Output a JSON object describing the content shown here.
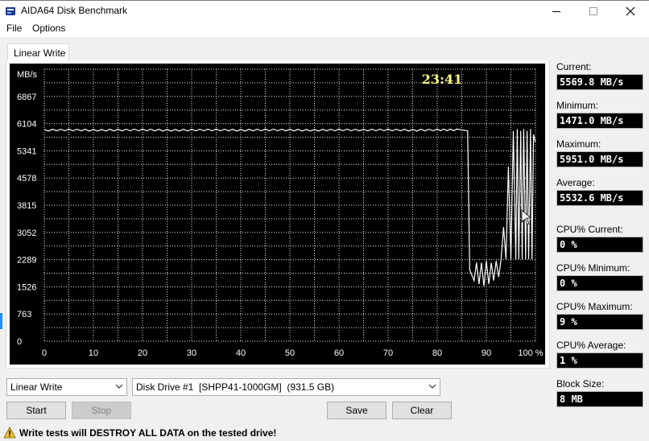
{
  "window": {
    "title": "AIDA64 Disk Benchmark"
  },
  "menu": {
    "items": [
      "File",
      "Options"
    ]
  },
  "tab": {
    "label": "Linear Write"
  },
  "chart_data": {
    "type": "line",
    "ylabel": "MB/s",
    "elapsed": "23:41",
    "yticks": [
      "6867",
      "6104",
      "5341",
      "4578",
      "3815",
      "3052",
      "2289",
      "1526",
      "763",
      "0"
    ],
    "xticks": [
      "0",
      "10",
      "20",
      "30",
      "40",
      "50",
      "60",
      "70",
      "80",
      "90",
      "100 %"
    ],
    "xlim": [
      0,
      100
    ],
    "ylim": [
      0,
      7630
    ],
    "grid": true,
    "color": "#ffffff",
    "series": [
      {
        "x": [
          0,
          5,
          10,
          15,
          20,
          25,
          30,
          35,
          40,
          45,
          50,
          55,
          60,
          65,
          70,
          75,
          80,
          84,
          86.2,
          86.6,
          87.5,
          88,
          88.5,
          89,
          89.5,
          90,
          90.5,
          91,
          91.5,
          92,
          92.5,
          93,
          93.5,
          94,
          94.5,
          95,
          95.5,
          96,
          96.3,
          96.6,
          97,
          97.3,
          97.6,
          98,
          98.3,
          98.6,
          99,
          99.3,
          99.6,
          100
        ],
        "y": [
          5940,
          5950,
          5940,
          5945,
          5950,
          5940,
          5945,
          5950,
          5940,
          5950,
          5945,
          5940,
          5950,
          5945,
          5950,
          5940,
          5950,
          5950,
          5900,
          2000,
          1700,
          2200,
          1600,
          2200,
          1550,
          2250,
          1600,
          2200,
          1700,
          2250,
          1800,
          2300,
          3200,
          2300,
          4900,
          2300,
          5900,
          2300,
          5951,
          2300,
          5900,
          2300,
          5951,
          2300,
          5900,
          2300,
          5951,
          2300,
          5800,
          5570
        ]
      }
    ]
  },
  "stats": [
    {
      "label": "Current:",
      "value": "5569.8 MB/s"
    },
    {
      "label": "Minimum:",
      "value": "1471.0 MB/s"
    },
    {
      "label": "Maximum:",
      "value": "5951.0 MB/s"
    },
    {
      "label": "Average:",
      "value": "5532.6 MB/s"
    },
    {
      "label": "CPU% Current:",
      "value": "0 %"
    },
    {
      "label": "CPU% Minimum:",
      "value": "0 %"
    },
    {
      "label": "CPU% Maximum:",
      "value": "9 %"
    },
    {
      "label": "CPU% Average:",
      "value": "1 %"
    },
    {
      "label": "Block Size:",
      "value": "8 MB"
    }
  ],
  "controls": {
    "test_select": "Linear Write",
    "drive_select": "Disk Drive #1  [SHPP41-1000GM]  (931.5 GB)",
    "start_label": "Start",
    "stop_label": "Stop",
    "save_label": "Save",
    "clear_label": "Clear"
  },
  "status": {
    "warning": "Write tests will DESTROY ALL DATA on the tested drive!"
  },
  "colors": {
    "chart_bg": "#000000",
    "elapsed_text": "#ffff80",
    "stat_text": "#ffffff",
    "warning_icon": "#f4c430"
  }
}
